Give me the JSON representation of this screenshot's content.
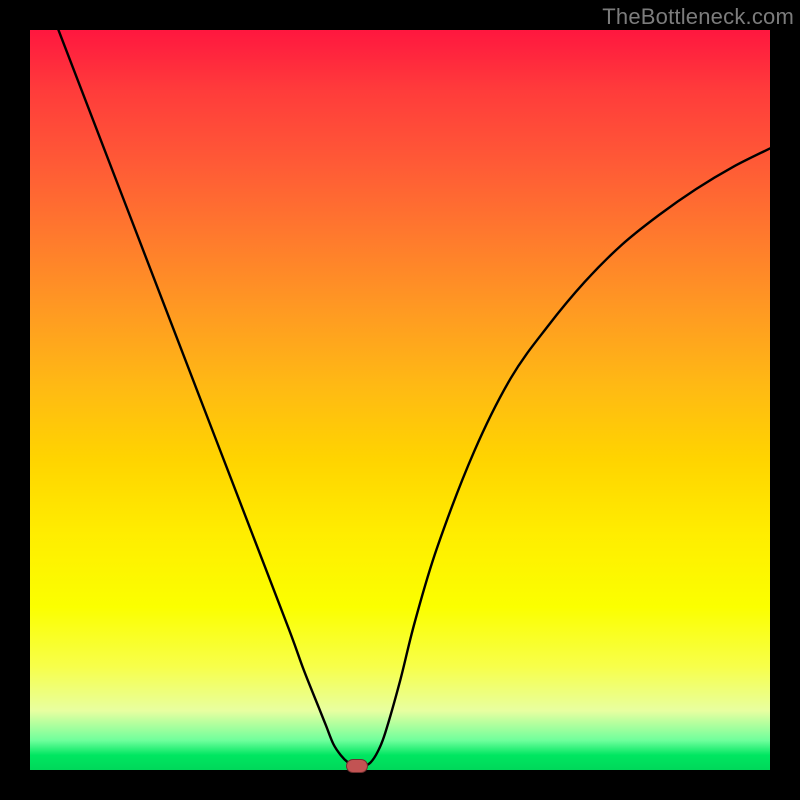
{
  "watermark": "TheBottleneck.com",
  "colors": {
    "curve_stroke": "#000000",
    "marker_fill": "#c25353",
    "marker_border": "#6e2f2f",
    "frame_bg": "#000000"
  },
  "chart_data": {
    "type": "line",
    "title": "",
    "xlabel": "",
    "ylabel": "",
    "xlim": [
      0,
      100
    ],
    "ylim": [
      0,
      100
    ],
    "grid": false,
    "legend": false,
    "series": [
      {
        "name": "curve",
        "x": [
          0,
          5,
          10,
          15,
          20,
          25,
          30,
          35,
          37,
          39,
          40,
          41,
          42,
          43,
          44,
          45,
          46,
          47,
          48,
          50,
          52,
          55,
          60,
          65,
          70,
          75,
          80,
          85,
          90,
          95,
          100
        ],
        "y": [
          110,
          97,
          84,
          71,
          58,
          45,
          32,
          19,
          13.5,
          8.5,
          6,
          3.5,
          2,
          1,
          0.5,
          0.5,
          1,
          2.5,
          5,
          12,
          20,
          30,
          43,
          53,
          60,
          66,
          71,
          75,
          78.5,
          81.5,
          84
        ]
      }
    ],
    "annotations": [
      {
        "name": "min-marker",
        "type": "marker",
        "shape": "rounded-rect",
        "x": 44.2,
        "y": 0.6
      }
    ]
  }
}
